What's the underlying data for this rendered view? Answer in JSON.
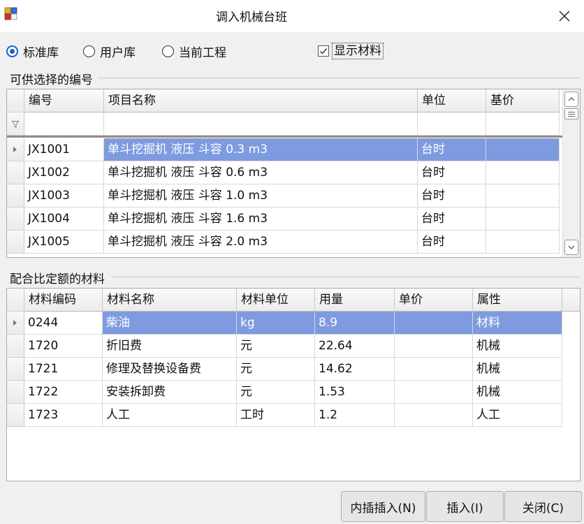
{
  "window": {
    "title": "调入机械台班"
  },
  "options": {
    "radios": [
      {
        "label": "标准库",
        "checked": true
      },
      {
        "label": "用户库",
        "checked": false
      },
      {
        "label": "当前工程",
        "checked": false
      }
    ],
    "show_materials": {
      "label": "显示材料",
      "checked": true
    }
  },
  "top_group": {
    "label": "可供选择的编号",
    "columns": [
      "编号",
      "项目名称",
      "单位",
      "基价"
    ],
    "rows": [
      [
        "JX1001",
        "单斗挖掘机 液压 斗容 0.3 m3",
        "台时",
        ""
      ],
      [
        "JX1002",
        "单斗挖掘机 液压 斗容 0.6 m3",
        "台时",
        ""
      ],
      [
        "JX1003",
        "单斗挖掘机 液压 斗容 1.0 m3",
        "台时",
        ""
      ],
      [
        "JX1004",
        "单斗挖掘机 液压 斗容 1.6 m3",
        "台时",
        ""
      ],
      [
        "JX1005",
        "单斗挖掘机 液压 斗容 2.0 m3",
        "台时",
        ""
      ]
    ],
    "selected_row": 0
  },
  "bottom_group": {
    "label": "配合比定额的材料",
    "columns": [
      "材料编码",
      "材料名称",
      "材料单位",
      "用量",
      "单价",
      "属性"
    ],
    "rows": [
      [
        "0244",
        "柴油",
        "kg",
        "8.9",
        "",
        "材料"
      ],
      [
        "1720",
        "折旧费",
        "元",
        "22.64",
        "",
        "机械"
      ],
      [
        "1721",
        "修理及替换设备费",
        "元",
        "14.62",
        "",
        "机械"
      ],
      [
        "1722",
        "安装拆卸费",
        "元",
        "1.53",
        "",
        "机械"
      ],
      [
        "1723",
        "人工",
        "工时",
        "1.2",
        "",
        "人工"
      ]
    ],
    "selected_row": 0
  },
  "buttons": {
    "inner_insert": "内插插入(N)",
    "insert": "插入(I)",
    "close": "关闭(C)"
  },
  "colors": {
    "selection": "#7e9be0",
    "radio_accent": "#1a5fd0"
  }
}
